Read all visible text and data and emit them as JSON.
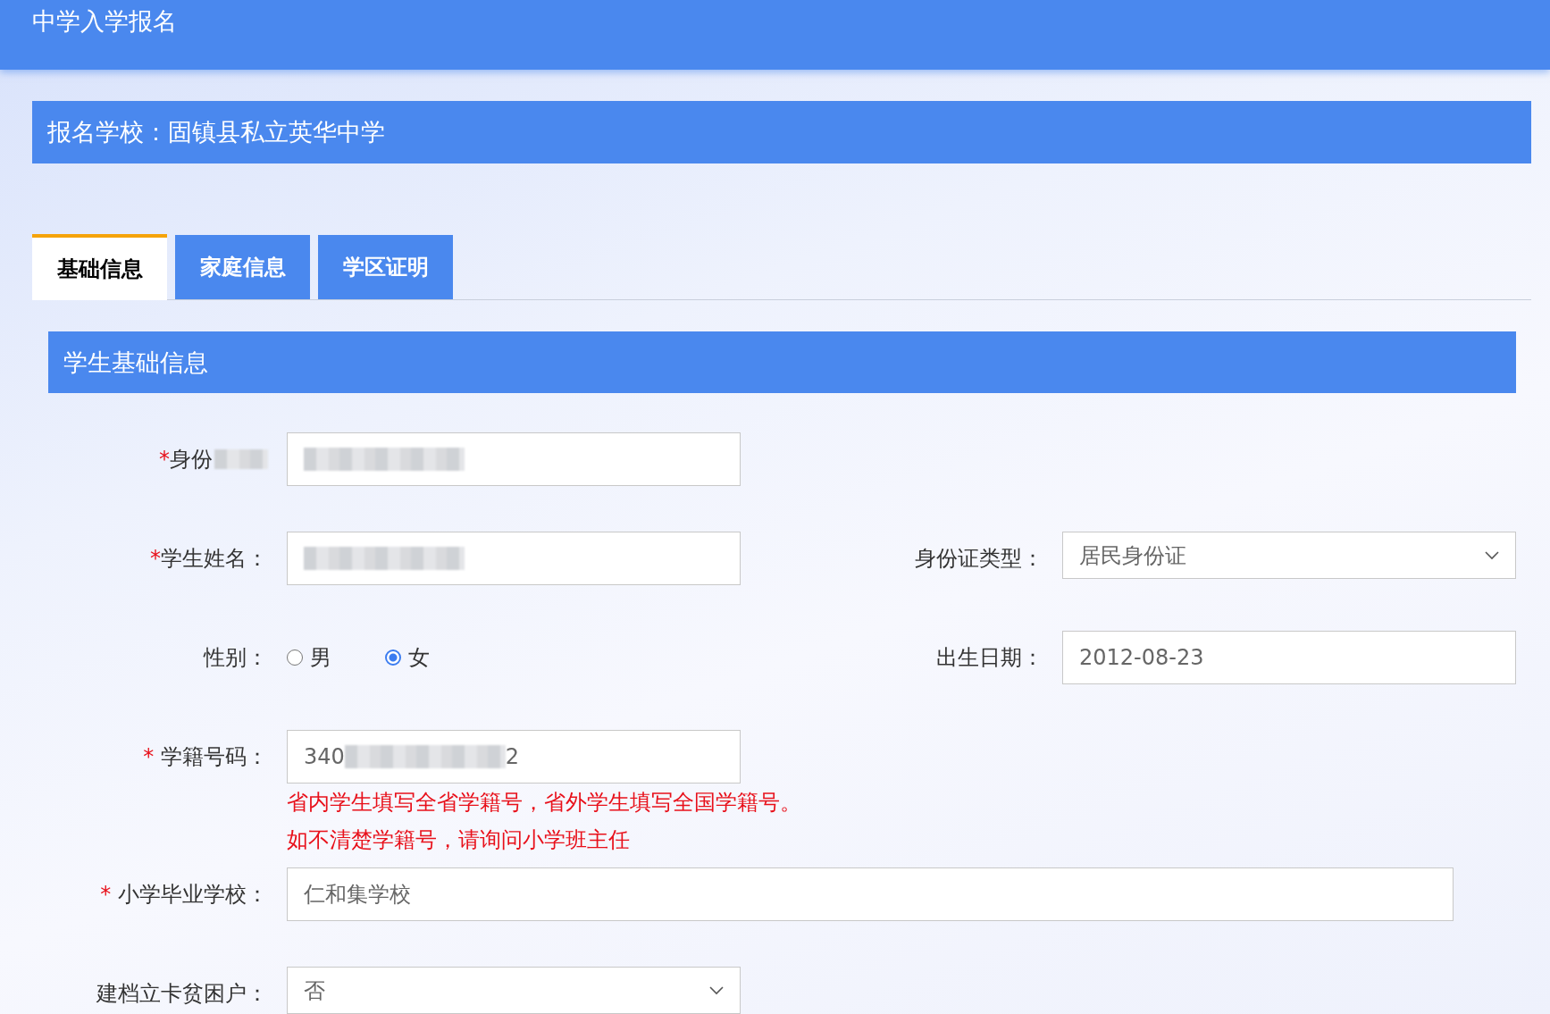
{
  "header": {
    "title": "中学入学报名"
  },
  "school_bar": {
    "text": "报名学校：固镇县私立英华中学"
  },
  "tabs": [
    {
      "label": "基础信息",
      "selected": true
    },
    {
      "label": "家庭信息",
      "selected": false
    },
    {
      "label": "学区证明",
      "selected": false
    }
  ],
  "section": {
    "title": "学生基础信息"
  },
  "rows": [
    {
      "fields": [
        {
          "kind": "input",
          "required": "*",
          "label": "身份",
          "label_redacted": true,
          "value_redacted": true
        }
      ]
    },
    {
      "fields": [
        {
          "kind": "input",
          "required": "*",
          "label": "学生姓名：",
          "value_redacted": true
        },
        {
          "kind": "select",
          "label": "身份证类型：",
          "value": "居民身份证"
        }
      ]
    },
    {
      "fields": [
        {
          "kind": "radio",
          "label": "性别：",
          "options": [
            {
              "label": "男",
              "selected": false
            },
            {
              "label": "女",
              "selected": true
            }
          ]
        },
        {
          "kind": "input",
          "label": "出生日期：",
          "value": "2012-08-23"
        }
      ]
    },
    {
      "fields": [
        {
          "kind": "input",
          "required": "* ",
          "label": "学籍号码：",
          "value": "340",
          "value_redacted": true,
          "value_suffix": "2",
          "hints": [
            "省内学生填写全省学籍号，省外学生填写全国学籍号。",
            "如不清楚学籍号，请询问小学班主任"
          ]
        }
      ]
    },
    {
      "fields": [
        {
          "kind": "input",
          "required": "* ",
          "label": "小学毕业学校：",
          "value": "仁和集学校",
          "wide": true
        }
      ]
    },
    {
      "fields": [
        {
          "kind": "select",
          "label": "建档立卡贫困户：",
          "value": "否"
        }
      ]
    }
  ]
}
